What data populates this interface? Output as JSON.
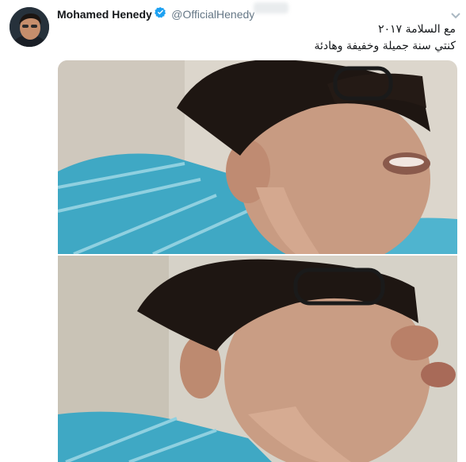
{
  "tweet": {
    "author": {
      "display_name": "Mohamed Henedy",
      "handle": "@OfficialHenedy",
      "verified": true,
      "avatar_icon": "profile-photo"
    },
    "text_lines": [
      "مع السلامة ٢٠١٧",
      "كنتي سنة جميلة وخفيفة وهادئة"
    ],
    "media": [
      {
        "alt": "photo",
        "icon": "photo"
      },
      {
        "alt": "photo",
        "icon": "photo"
      }
    ]
  },
  "colors": {
    "verified_badge": "#1da1f2",
    "handle_text": "#657786",
    "text": "#14171a",
    "chevron": "#aab8c2"
  }
}
